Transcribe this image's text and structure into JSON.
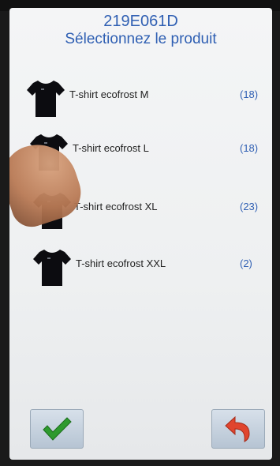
{
  "header": {
    "reference": "219E061D",
    "title": "Sélectionnez le produit"
  },
  "products": [
    {
      "label": "T-shirt ecofrost M",
      "count": "(18)"
    },
    {
      "label": "T-shirt ecofrost L",
      "count": "(18)"
    },
    {
      "label": "T-shirt ecofrost XL",
      "count": "(23)"
    },
    {
      "label": "T-shirt ecofrost XXL",
      "count": "(2)"
    }
  ],
  "icons": {
    "product": "tshirt-icon",
    "confirm": "checkmark-icon",
    "back": "back-arrow-icon"
  },
  "colors": {
    "accent": "#2f5fb3",
    "confirm": "#2e9a2e",
    "back": "#e0452e"
  }
}
